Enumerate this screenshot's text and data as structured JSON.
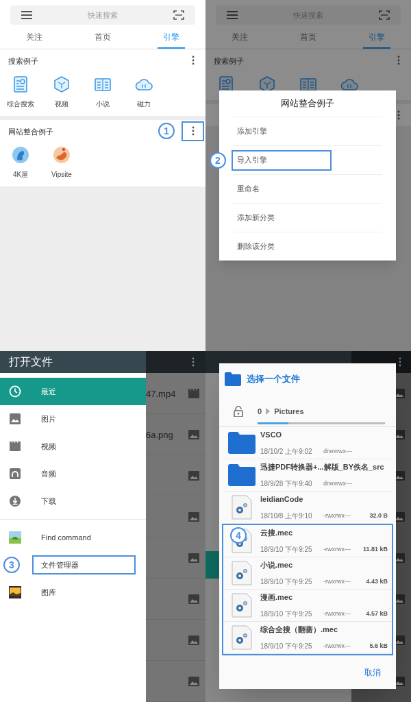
{
  "panels": [
    {
      "kind": "engine_home",
      "search": {
        "placeholder": "快速搜索"
      },
      "tabs": [
        {
          "label": "关注",
          "selected": false
        },
        {
          "label": "首页",
          "selected": false
        },
        {
          "label": "引擎",
          "selected": true
        }
      ],
      "sections": [
        {
          "title": "搜索例子",
          "menu": true,
          "items": [
            {
              "kind": "document",
              "label": "综合搜索"
            },
            {
              "kind": "cube",
              "label": "视频"
            },
            {
              "kind": "book",
              "label": "小说"
            },
            {
              "kind": "cloud",
              "label": "磁力"
            }
          ]
        },
        {
          "title": "网站整合例子",
          "menu": true,
          "menu_callout": "1",
          "items": [
            {
              "kind": "app_blue",
              "label": "4K屋"
            },
            {
              "kind": "app_orange",
              "label": "Vipsite"
            }
          ]
        }
      ]
    },
    {
      "kind": "engine_dialog",
      "search": {
        "placeholder": "快速搜索"
      },
      "tabs": [
        {
          "label": "关注",
          "selected": false
        },
        {
          "label": "首页",
          "selected": false
        },
        {
          "label": "引擎",
          "selected": true
        }
      ],
      "sections": [
        {
          "title": "搜索例子",
          "menu": true,
          "items": [
            {
              "kind": "document"
            },
            {
              "kind": "cube"
            },
            {
              "kind": "book"
            },
            {
              "kind": "cloud"
            }
          ]
        },
        {
          "menu": true
        }
      ],
      "dialog": {
        "title": "网站整合例子",
        "items": [
          {
            "label": "添加引擎"
          },
          {
            "label": "导入引擎",
            "callout": "2"
          },
          {
            "label": "重命名"
          },
          {
            "label": "添加新分类"
          },
          {
            "label": "删除该分类"
          }
        ]
      }
    },
    {
      "kind": "drawer",
      "title": "打开文件",
      "drawer_groups": [
        {
          "items": [
            {
              "kind": "clock",
              "label": "最近",
              "selected": true
            },
            {
              "kind": "image",
              "label": "图片",
              "selected": false
            },
            {
              "kind": "video",
              "label": "视频",
              "selected": false
            },
            {
              "kind": "audio",
              "label": "音频",
              "selected": false
            },
            {
              "kind": "download",
              "label": "下载",
              "selected": false
            }
          ]
        },
        {
          "items": [
            {
              "kind": "android",
              "label": "Find command",
              "selected": false
            },
            {
              "label": "文件管理器",
              "selected": false,
              "callout": "3"
            },
            {
              "kind": "gallery",
              "label": "图库",
              "selected": false
            }
          ]
        }
      ],
      "behind": [
        {
          "kind": "video",
          "name": "47.mp4"
        },
        {
          "kind": "image",
          "name": "6a.png"
        },
        {
          "kind": "image"
        },
        {
          "kind": "image"
        },
        {
          "kind": "image"
        },
        {
          "kind": "image"
        },
        {
          "kind": "image"
        },
        {
          "kind": "image"
        }
      ]
    },
    {
      "kind": "file_chooser",
      "dialog": {
        "title": "选择一个文件",
        "path": [
          "0",
          "Pictures"
        ],
        "callout": "4",
        "cancel": "取消",
        "files": [
          {
            "kind": "folder",
            "name": "VSCO",
            "date": "18/10/2 上午9:02",
            "perms": "drwxrwx---",
            "highlighted": false
          },
          {
            "kind": "folder",
            "name": "迅捷PDF转换器+...解版_BY佚名_src",
            "date": "18/9/28 下午9:40",
            "perms": "drwxrwx---",
            "highlighted": false
          },
          {
            "kind": "file",
            "name": "leidianCode",
            "date": "18/10/8 上午9:10",
            "perms": "-rwxrwx---",
            "size": "32.0 B",
            "highlighted": false
          },
          {
            "kind": "file",
            "name": "云搜.mec",
            "date": "18/9/10 下午9:25",
            "perms": "-rwxrwx---",
            "size": "11.81 kB",
            "highlighted": true
          },
          {
            "kind": "file",
            "name": "小说.mec",
            "date": "18/9/10 下午9:25",
            "perms": "-rwxrwx---",
            "size": "4.43 kB",
            "highlighted": true
          },
          {
            "kind": "file",
            "name": "漫画.mec",
            "date": "18/9/10 下午9:25",
            "perms": "-rwxrwx---",
            "size": "4.57 kB",
            "highlighted": true
          },
          {
            "kind": "file",
            "name": "综合全搜（翻蔷）.mec",
            "date": "18/9/10 下午9:25",
            "perms": "-rwxrwx---",
            "size": "5.6 kB",
            "highlighted": true
          }
        ]
      }
    }
  ]
}
